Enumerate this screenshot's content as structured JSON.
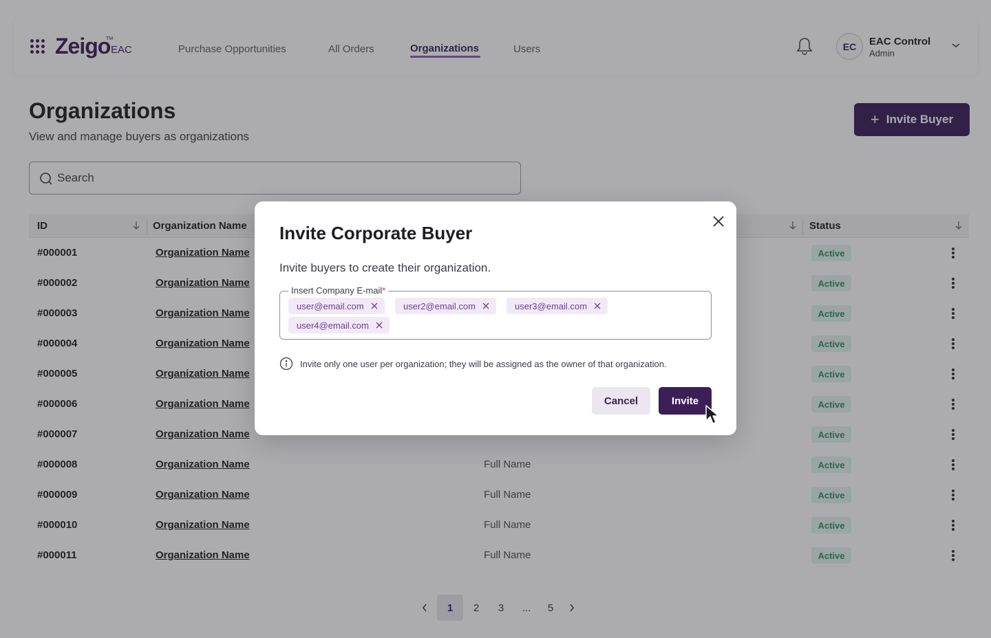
{
  "header": {
    "logo": "Zeigo",
    "logo_tm": "TM",
    "logo_sub": "EAC",
    "nav": [
      {
        "label": "Purchase Opportunities"
      },
      {
        "label": "All Orders"
      },
      {
        "label": "Organizations"
      },
      {
        "label": "Users"
      }
    ],
    "active_nav": "Organizations",
    "user": {
      "initials": "EC",
      "name": "EAC Control",
      "role": "Admin"
    }
  },
  "page": {
    "title": "Organizations",
    "subtitle": "View and manage buyers as organizations",
    "invite_button": "Invite Buyer",
    "search_placeholder": "Search"
  },
  "table": {
    "columns": [
      "ID",
      "Organization Name",
      "Status"
    ],
    "rows": [
      {
        "id": "#000001",
        "org": "Organization Name",
        "full": "",
        "status": "Active"
      },
      {
        "id": "#000002",
        "org": "Organization Name",
        "full": "",
        "status": "Active"
      },
      {
        "id": "#000003",
        "org": "Organization Name",
        "full": "",
        "status": "Active"
      },
      {
        "id": "#000004",
        "org": "Organization Name",
        "full": "",
        "status": "Active"
      },
      {
        "id": "#000005",
        "org": "Organization Name",
        "full": "",
        "status": "Active"
      },
      {
        "id": "#000006",
        "org": "Organization Name",
        "full": "",
        "status": "Active"
      },
      {
        "id": "#000007",
        "org": "Organization Name",
        "full": "",
        "status": "Active"
      },
      {
        "id": "#000008",
        "org": "Organization Name",
        "full": "Full Name",
        "status": "Active"
      },
      {
        "id": "#000009",
        "org": "Organization Name",
        "full": "Full Name",
        "status": "Active"
      },
      {
        "id": "#000010",
        "org": "Organization Name",
        "full": "Full Name",
        "status": "Active"
      },
      {
        "id": "#000011",
        "org": "Organization Name",
        "full": "Full Name",
        "status": "Active"
      }
    ]
  },
  "pagination": {
    "pages": [
      "1",
      "2",
      "3",
      "...",
      "5"
    ],
    "current": "1"
  },
  "modal": {
    "title": "Invite Corporate Buyer",
    "description": "Invite buyers to create their organization.",
    "field_label": "Insert Company E-mail",
    "required_mark": "*",
    "emails": [
      "user@email.com",
      "user2@email.com",
      "user3@email.com",
      "user4@email.com"
    ],
    "info": "Invite only one user per organization; they will be assigned as the owner of that organization.",
    "cancel": "Cancel",
    "invite": "Invite"
  },
  "colors": {
    "brand": "#3b1f57",
    "accent_underline": "#8e5ab3",
    "chip_bg": "#f1eaf6",
    "status_active_bg": "#e4f4ec",
    "status_active_text": "#2e8f63"
  }
}
